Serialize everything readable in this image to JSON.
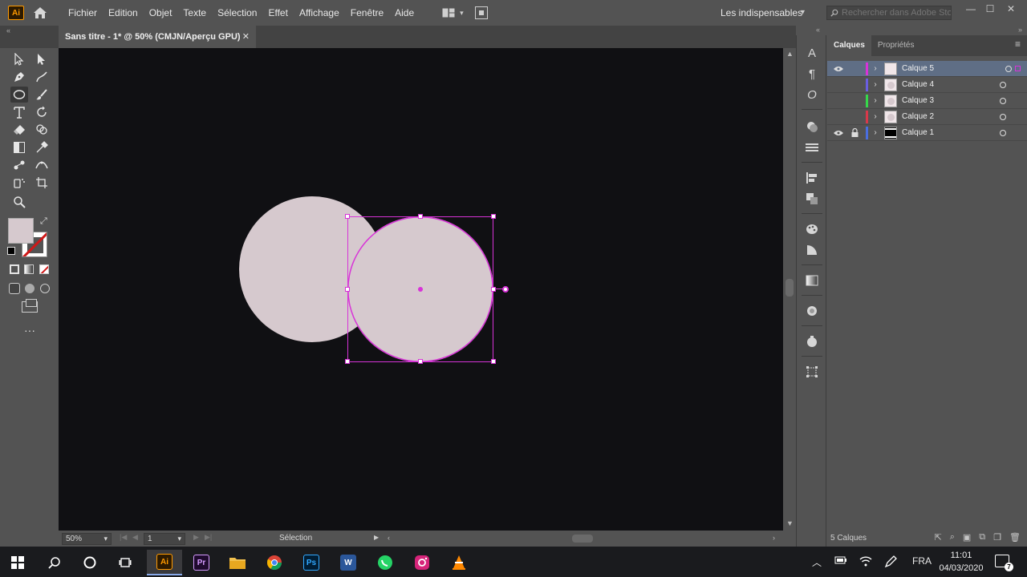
{
  "app": {
    "logo_text": "Ai",
    "menu": [
      "Fichier",
      "Edition",
      "Objet",
      "Texte",
      "Sélection",
      "Effet",
      "Affichage",
      "Fenêtre",
      "Aide"
    ],
    "workspace": "Les indispensables",
    "search_placeholder": "Rechercher dans Adobe Stock"
  },
  "document": {
    "tab_title": "Sans titre - 1* @ 50% (CMJN/Aperçu GPU)"
  },
  "toolbar": {
    "fill_color": "#d6c9ce"
  },
  "canvas": {
    "background": "#101013",
    "shape_fill": "#d6c9ce",
    "selection_color": "#d833d8"
  },
  "statusbar": {
    "zoom": "50%",
    "artboard": "1",
    "status": "Sélection"
  },
  "layers_panel": {
    "tabs": [
      "Calques",
      "Propriétés"
    ],
    "layers": [
      {
        "name": "Calque 5",
        "color": "#d833d8",
        "visible": true,
        "locked": false,
        "selected": true
      },
      {
        "name": "Calque 4",
        "color": "#6a5ee0",
        "visible": false,
        "locked": false,
        "selected": false
      },
      {
        "name": "Calque 3",
        "color": "#36d84a",
        "visible": false,
        "locked": false,
        "selected": false
      },
      {
        "name": "Calque 2",
        "color": "#d8384a",
        "visible": false,
        "locked": false,
        "selected": false
      },
      {
        "name": "Calque 1",
        "color": "#4a6ee0",
        "visible": true,
        "locked": true,
        "selected": false
      }
    ],
    "footer": "5 Calques"
  },
  "taskbar": {
    "apps": [
      "Windows",
      "Search",
      "Cortana",
      "Task View",
      "Illustrator",
      "Premiere Pro",
      "File Explorer",
      "Chrome",
      "Photoshop",
      "Word",
      "WhatsApp",
      "Instagram",
      "VLC"
    ],
    "language": "FRA",
    "time": "11:01",
    "date": "04/03/2020",
    "notifications": "7"
  }
}
